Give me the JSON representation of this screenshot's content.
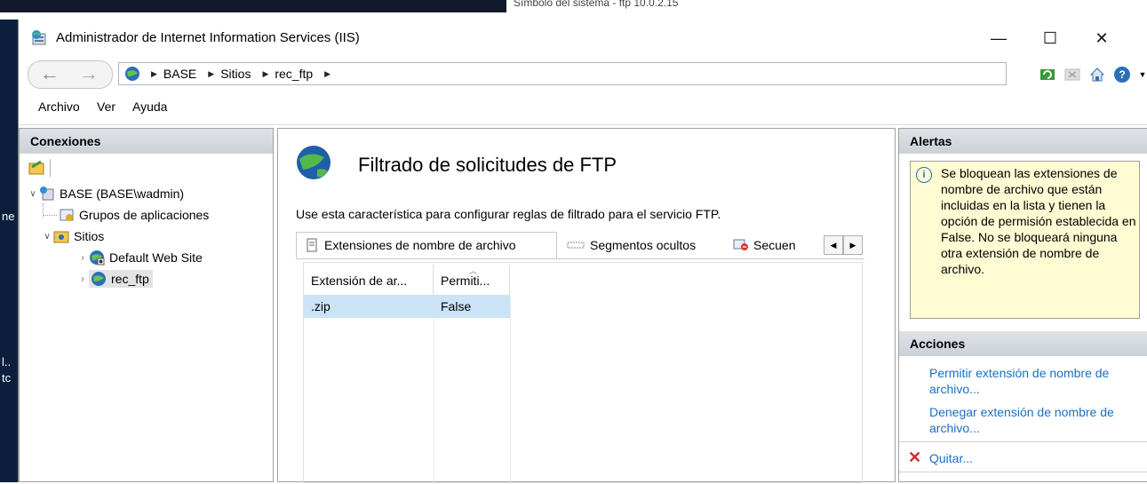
{
  "background": {
    "cmd_title": "Símbolo del sistema - ftp 10.0.2.15",
    "left_fragments": [
      "ne",
      "l..",
      "tc"
    ]
  },
  "window": {
    "title": "Administrador de Internet Information Services (IIS)",
    "controls": {
      "minimize": "—",
      "maximize": "☐",
      "close": "✕"
    }
  },
  "address": {
    "crumbs": [
      "BASE",
      "Sitios",
      "rec_ftp"
    ]
  },
  "menu": [
    "Archivo",
    "Ver",
    "Ayuda"
  ],
  "connections": {
    "header": "Conexiones",
    "tree": [
      {
        "label": "BASE (BASE\\wadmin)"
      },
      {
        "label": "Grupos de aplicaciones"
      },
      {
        "label": "Sitios"
      },
      {
        "label": "Default Web Site"
      },
      {
        "label": "rec_ftp"
      }
    ]
  },
  "feature": {
    "title": "Filtrado de solicitudes de FTP",
    "description": "Use esta característica para configurar reglas de filtrado para el servicio FTP.",
    "tabs": [
      "Extensiones de nombre de archivo",
      "Segmentos ocultos",
      "Secuen"
    ],
    "columns": [
      "Extensión de ar...",
      "Permiti..."
    ],
    "rows": [
      {
        "extension": ".zip",
        "allowed": "False"
      }
    ]
  },
  "alerts": {
    "header": "Alertas",
    "text": "Se bloquean las extensiones de nombre de archivo que están incluidas en la lista y tienen la opción de permisión establecida en False. No se bloqueará ninguna otra extensión de nombre de archivo."
  },
  "actions": {
    "header": "Acciones",
    "items": [
      "Permitir extensión de nombre de archivo...",
      "Denegar extensión de nombre de archivo...",
      "Quitar..."
    ]
  },
  "colors": {
    "accent_link": "#1a6fc4",
    "selection": "#cce3f7",
    "alert_bg": "#fffbd2"
  }
}
